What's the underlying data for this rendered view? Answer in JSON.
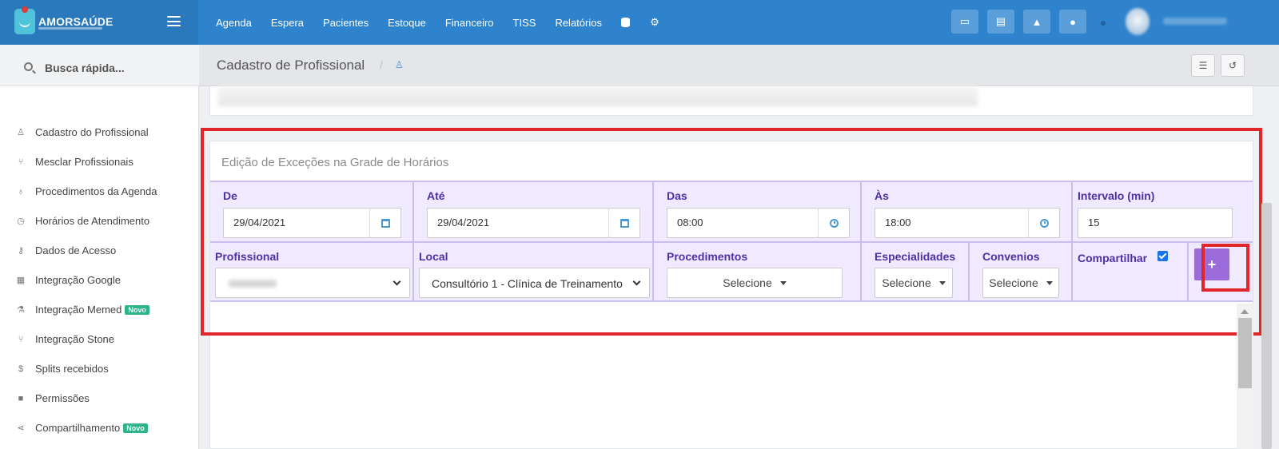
{
  "app": {
    "brand": "AMORSAÚDE"
  },
  "topnav": {
    "items": [
      "Agenda",
      "Espera",
      "Pacientes",
      "Estoque",
      "Financeiro",
      "TISS",
      "Relatórios"
    ],
    "icons": [
      "database-icon",
      "gear-icon"
    ],
    "buttons": [
      "inbox-icon",
      "card-icon",
      "bell-icon",
      "chat-icon"
    ]
  },
  "search": {
    "placeholder": "Busca rápida..."
  },
  "sidebar": {
    "items": [
      {
        "label": "Cadastro do Profissional",
        "icon": "user-md-icon"
      },
      {
        "label": "Mesclar Profissionais",
        "icon": "merge-icon"
      },
      {
        "label": "Procedimentos da Agenda",
        "icon": "stethoscope-icon"
      },
      {
        "label": "Horários de Atendimento",
        "icon": "clock-icon"
      },
      {
        "label": "Dados de Acesso",
        "icon": "key-icon"
      },
      {
        "label": "Integração Google",
        "icon": "calendar-icon"
      },
      {
        "label": "Integração Memed",
        "icon": "flask-icon",
        "badge": "Novo"
      },
      {
        "label": "Integração Stone",
        "icon": "merge-icon"
      },
      {
        "label": "Splits recebidos",
        "icon": "dollar-icon"
      },
      {
        "label": "Permissões",
        "icon": "lock-icon"
      },
      {
        "label": "Compartilhamento",
        "icon": "share-icon",
        "badge": "Novo"
      }
    ]
  },
  "breadcrumb": {
    "title": "Cadastro de Profissional",
    "sep": "/"
  },
  "card": {
    "title": "Edição de Exceções na Grade de Horários"
  },
  "form": {
    "de": {
      "label": "De",
      "value": "29/04/2021"
    },
    "ate": {
      "label": "Até",
      "value": "29/04/2021"
    },
    "das": {
      "label": "Das",
      "value": "08:00"
    },
    "as": {
      "label": "Às",
      "value": "18:00"
    },
    "intervalo": {
      "label": "Intervalo (min)",
      "value": "15"
    },
    "profissional": {
      "label": "Profissional"
    },
    "local": {
      "label": "Local",
      "value": "Consultório 1 - Clínica de Treinamento"
    },
    "procedimentos": {
      "label": "Procedimentos",
      "value": "Selecione"
    },
    "especialidades": {
      "label": "Especialidades",
      "value": "Selecione"
    },
    "convenios": {
      "label": "Convenios",
      "value": "Selecione"
    },
    "compartilhar": {
      "label": "Compartilhar",
      "checked": true
    },
    "add_label": "+"
  },
  "colors": {
    "topbar": "#2e83cc",
    "accent_purple": "#4f2fa3",
    "add_button": "#9b6bdc",
    "highlight": "#e0262a"
  }
}
